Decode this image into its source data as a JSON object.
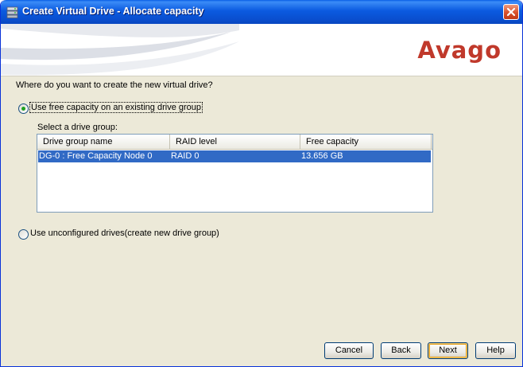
{
  "window": {
    "title": "Create Virtual Drive - Allocate capacity",
    "logo_text": "Avago"
  },
  "content": {
    "question": "Where do you want to create the new virtual drive?",
    "option_existing": {
      "label": "Use free capacity on an existing drive group",
      "selected": true
    },
    "select_label": "Select a drive group:",
    "table": {
      "columns": [
        "Drive group name",
        "RAID level",
        "Free capacity"
      ],
      "rows": [
        {
          "name": "DG-0 : Free Capacity Node 0",
          "raid": "RAID 0",
          "free": "13.656 GB",
          "selected": true
        }
      ]
    },
    "option_new": {
      "label": "Use unconfigured drives(create new drive group)",
      "selected": false
    }
  },
  "buttons": {
    "cancel": "Cancel",
    "back": "Back",
    "next": "Next",
    "help": "Help"
  },
  "colors": {
    "titlebar": "#0a5fe6",
    "selection": "#316ac5",
    "logo": "#c0392b",
    "dialog_bg": "#ece9d8"
  }
}
